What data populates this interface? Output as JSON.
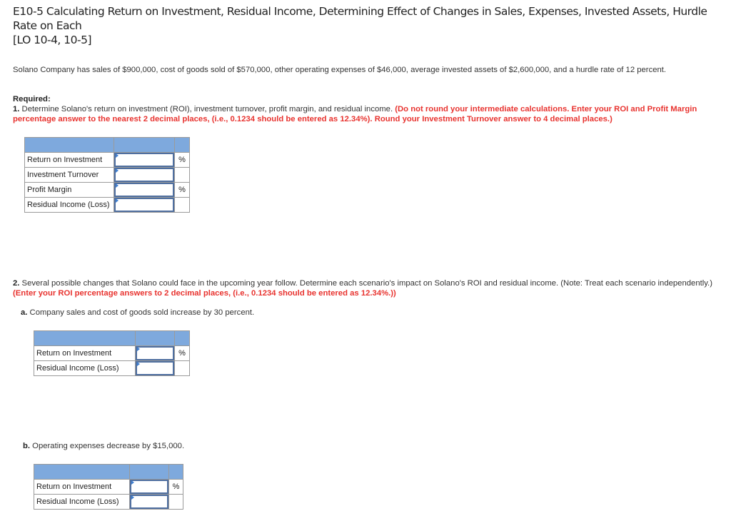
{
  "title": {
    "line1": "E10-5 Calculating Return on Investment, Residual Income, Determining Effect of Changes in Sales, Expenses, Invested Assets, Hurdle Rate on Each",
    "line2": "[LO 10-4, 10-5]"
  },
  "intro": "Solano Company has sales of $900,000, cost of goods sold of $570,000, other operating expenses of $46,000, average invested assets of $2,600,000, and a hurdle rate of 12 percent.",
  "required": {
    "heading": "Required:",
    "q1_number": "1.",
    "q1_text": " Determine Solano's return on investment (ROI), investment turnover, profit margin, and residual income. ",
    "q1_instruction": "(Do not round your intermediate calculations. Enter your ROI and Profit Margin percentage answer to the nearest 2 decimal places, (i.e., 0.1234 should be entered as 12.34%). Round your Investment Turnover answer to 4 decimal places.)"
  },
  "table1": {
    "rows": [
      {
        "label": "Return on Investment",
        "value": "",
        "unit": "%"
      },
      {
        "label": "Investment Turnover",
        "value": "",
        "unit": ""
      },
      {
        "label": "Profit Margin",
        "value": "",
        "unit": "%"
      },
      {
        "label": "Residual Income (Loss)",
        "value": "",
        "unit": ""
      }
    ]
  },
  "q2": {
    "number": "2.",
    "text": " Several possible changes that Solano could face in the upcoming year follow. Determine each scenario's impact on Solano's ROI and residual income. (Note: Treat each scenario independently.) ",
    "instruction": "(Enter your ROI percentage answers to 2 decimal places, (i.e., 0.1234 should be entered as 12.34%.))"
  },
  "scenario_a": {
    "letter": "a.",
    "text": " Company sales and cost of goods sold increase by 30 percent.",
    "rows": [
      {
        "label": "Return on Investment",
        "value": "",
        "unit": "%"
      },
      {
        "label": "Residual Income (Loss)",
        "value": "",
        "unit": ""
      }
    ]
  },
  "scenario_b": {
    "letter": "b.",
    "text": " Operating expenses decrease by $15,000.",
    "rows": [
      {
        "label": "Return on Investment",
        "value": "",
        "unit": "%"
      },
      {
        "label": "Residual Income (Loss)",
        "value": "",
        "unit": ""
      }
    ]
  },
  "colors": {
    "header_fill": "#7ea9dd",
    "instruction_red": "#e8332f",
    "input_border": "#4f6fa0"
  }
}
